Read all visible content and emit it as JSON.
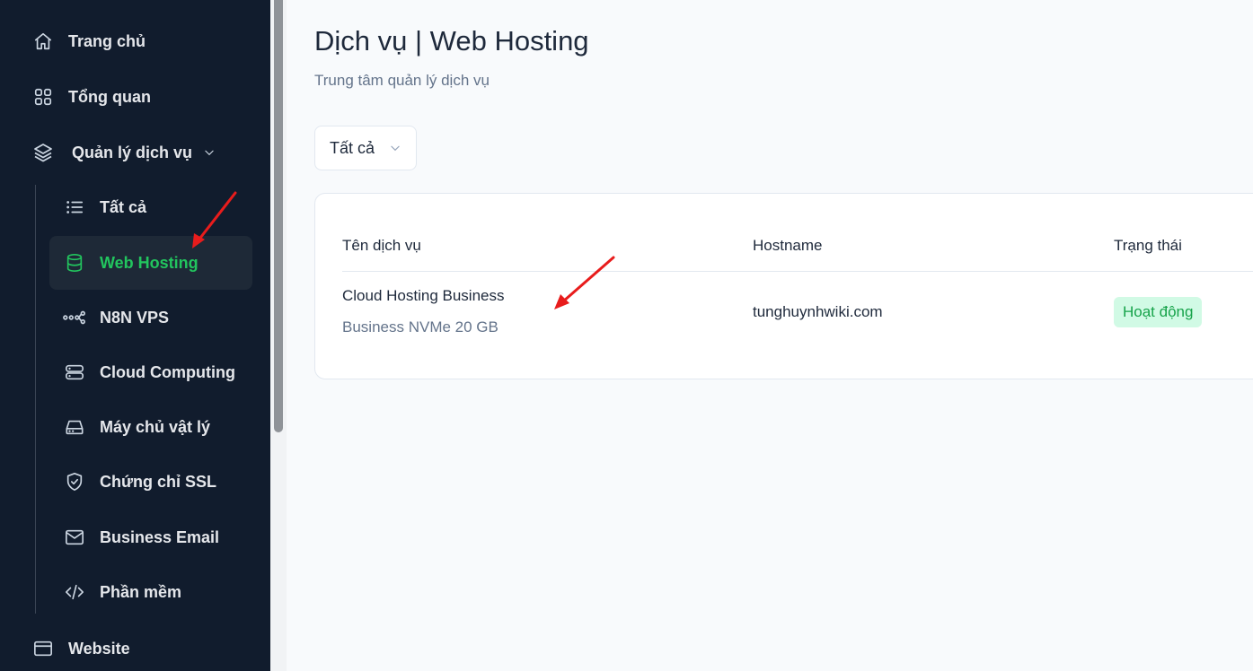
{
  "sidebar": {
    "top_items": [
      {
        "label": "Trang chủ",
        "icon": "home-icon"
      },
      {
        "label": "Tổng quan",
        "icon": "grid-icon"
      },
      {
        "label": "Quản lý dịch vụ",
        "icon": "layers-icon"
      }
    ],
    "sub_items": [
      {
        "label": "Tất cả",
        "icon": "list-icon"
      },
      {
        "label": "Web Hosting",
        "icon": "database-icon",
        "active": true
      },
      {
        "label": "N8N VPS",
        "icon": "workflow-icon"
      },
      {
        "label": "Cloud Computing",
        "icon": "server-icon"
      },
      {
        "label": "Máy chủ vật lý",
        "icon": "hard-drive-icon"
      },
      {
        "label": "Chứng chỉ SSL",
        "icon": "shield-check-icon"
      },
      {
        "label": "Business Email",
        "icon": "mail-icon"
      },
      {
        "label": "Phần mềm",
        "icon": "code-icon"
      }
    ],
    "bottom_items": [
      {
        "label": "Website",
        "icon": "browser-window-icon"
      }
    ]
  },
  "main": {
    "title": "Dịch vụ | Web Hosting",
    "subtitle": "Trung tâm quản lý dịch vụ",
    "filter": {
      "selected": "Tất cả"
    },
    "table": {
      "headers": [
        "Tên dịch vụ",
        "Hostname",
        "Trạng thái"
      ],
      "rows": [
        {
          "name": "Cloud Hosting Business",
          "plan": "Business NVMe 20 GB",
          "hostname": "tunghuynhwiki.com",
          "status": "Hoạt động"
        }
      ]
    }
  },
  "colors": {
    "sidebar_bg": "#111c2d",
    "accent_green": "#22c55e",
    "badge_bg": "#d1fae5",
    "badge_text": "#16a34a",
    "annotation_arrow": "#e81c1c"
  }
}
